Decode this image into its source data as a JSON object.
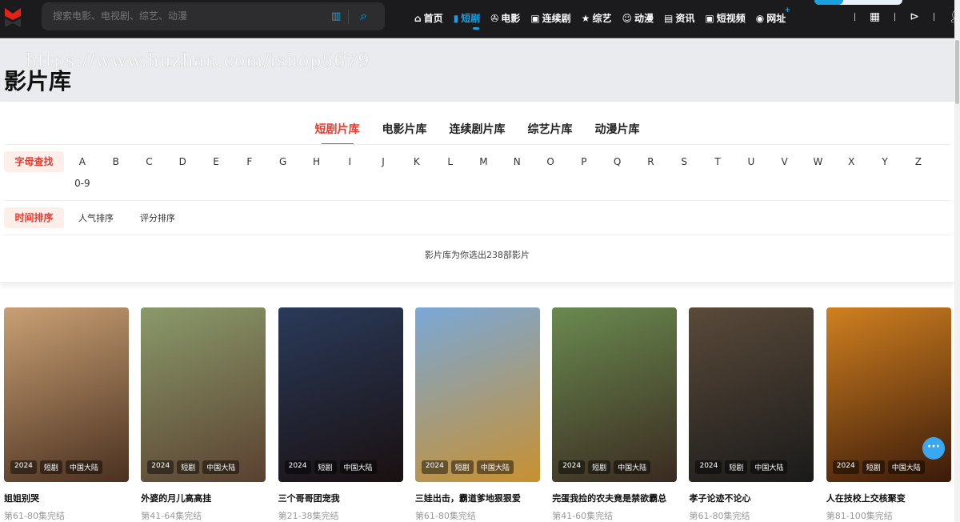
{
  "header": {
    "search_placeholder": "搜索电影、电视剧、综艺、动漫",
    "nav": [
      {
        "label": "首页",
        "icon": "home-icon",
        "glyph": "⌂"
      },
      {
        "label": "短剧",
        "icon": "file-icon",
        "glyph": "▮",
        "active": true
      },
      {
        "label": "电影",
        "icon": "film-reel-icon",
        "glyph": "✇"
      },
      {
        "label": "连续剧",
        "icon": "tv-icon",
        "glyph": "▣"
      },
      {
        "label": "综艺",
        "icon": "star-icon",
        "glyph": "★"
      },
      {
        "label": "动漫",
        "icon": "robot-icon",
        "glyph": "☺"
      },
      {
        "label": "资讯",
        "icon": "news-icon",
        "glyph": "▤"
      },
      {
        "label": "短视频",
        "icon": "video-icon",
        "glyph": "▣"
      },
      {
        "label": "网址",
        "icon": "globe-icon",
        "glyph": "◉",
        "badge": "+"
      }
    ]
  },
  "watermark": "https://www.huzhan.com/ishop5679",
  "page_title": "影片库",
  "tabs": [
    "短剧片库",
    "电影片库",
    "连续剧片库",
    "综艺片库",
    "动漫片库"
  ],
  "filters": {
    "letter_label": "字母查找",
    "letters": [
      "A",
      "B",
      "C",
      "D",
      "E",
      "F",
      "G",
      "H",
      "I",
      "J",
      "K",
      "L",
      "M",
      "N",
      "O",
      "P",
      "Q",
      "R",
      "S",
      "T",
      "U",
      "V",
      "W",
      "X",
      "Y",
      "Z",
      "0-9"
    ],
    "sort_label": "时间排序",
    "sorts": [
      "人气排序",
      "评分排序"
    ]
  },
  "count_text": "影片库为你选出238部影片",
  "cards": [
    {
      "title": "姐姐别哭",
      "sub": "第61-80集完结",
      "year": "2024",
      "type": "短剧",
      "region": "中国大陆",
      "colors": [
        "#c9a074",
        "#4a3020"
      ]
    },
    {
      "title": "外婆的月儿高高挂",
      "sub": "第41-64集完结",
      "year": "2024",
      "type": "短剧",
      "region": "中国大陆",
      "colors": [
        "#8a9a6a",
        "#5a4030"
      ]
    },
    {
      "title": "三个哥哥团宠我",
      "sub": "第21-38集完结",
      "year": "2024",
      "type": "短剧",
      "region": "中国大陆",
      "colors": [
        "#2a3a5a",
        "#1a1010"
      ]
    },
    {
      "title": "三娃出击，霸道爹地狠狠爱",
      "sub": "第61-80集完结",
      "year": "2024",
      "type": "短剧",
      "region": "中国大陆",
      "colors": [
        "#7aa8d8",
        "#c89030"
      ]
    },
    {
      "title": "完蛋我捡的农夫竟是禁欲霸总",
      "sub": "第41-60集完结",
      "year": "2024",
      "type": "短剧",
      "region": "中国大陆",
      "colors": [
        "#6a8a50",
        "#3a2a20"
      ]
    },
    {
      "title": "孝子论迹不论心",
      "sub": "第61-80集完结",
      "year": "2024",
      "type": "短剧",
      "region": "中国大陆",
      "colors": [
        "#5a4a3a",
        "#1a1a1a"
      ]
    },
    {
      "title": "人在技校上交核聚变",
      "sub": "第81-100集完结",
      "year": "2024",
      "type": "短剧",
      "region": "中国大陆",
      "colors": [
        "#d08020",
        "#3a1a0a"
      ]
    }
  ]
}
